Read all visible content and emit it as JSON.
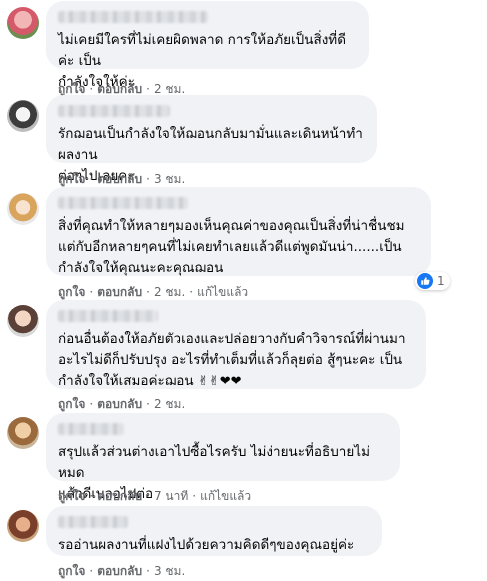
{
  "actions": {
    "like": "ถูกใจ",
    "reply": "ตอบกลับ",
    "edited": "แก้ไขแล้ว"
  },
  "comments": [
    {
      "text": "ไม่เคยมีใครที่ไม่เคยผิดพลาด การให้อภัยเป็นสิ่งที่ดีค่ะ เป็น\nกำลังใจให้ค่ะ",
      "time": "2 ชม."
    },
    {
      "text": "รักฌอนเป็นกำลังใจให้ฌอนกลับมามั่นและเดินหน้าทำผลงาน\nต่อๆไปเลยคะ",
      "time": "3 ชม."
    },
    {
      "text": "สิ่งที่คุณทำให้หลายๆมองเห็นคุณค่าของคุณเป็นสิ่งที่น่าชื่นชม\nแต่กับอีกหลายๆคนที่ไม่เคยทำเลยแล้วดีแต่พูดมันน่า......เป็น\nกำลังใจให้คุณนะคะคุณฌอน",
      "time": "2 ชม.",
      "reaction_count": "1"
    },
    {
      "text": "ก่อนอื่นต้องให้อภัยตัวเองและปล่อยวางกับคำวิจารณ์ที่ผ่านมา\nอะไรไม่ดีก็ปรับปรุง อะไรที่ทำเต็มที่แล้วก็ลุยต่อ สู้ๆนะคะ เป็น\nกำลังใจให้เสมอค่ะฌอน",
      "emojis": "✌✌❤❤",
      "time": "2 ชม."
    },
    {
      "text": "สรุปแล้วส่วนต่างเอาไปซื้อไรครับ ไม่ง่ายนะที่อธิบายไม่หมด\nแล้วดีเบลอไปต่อ",
      "time": "7 นาที"
    },
    {
      "text": "รออ่านผลงานที่แฝงไปด้วยความคิดดีๆของคุณอยู่ค่ะ",
      "time": "3 ชม."
    }
  ]
}
